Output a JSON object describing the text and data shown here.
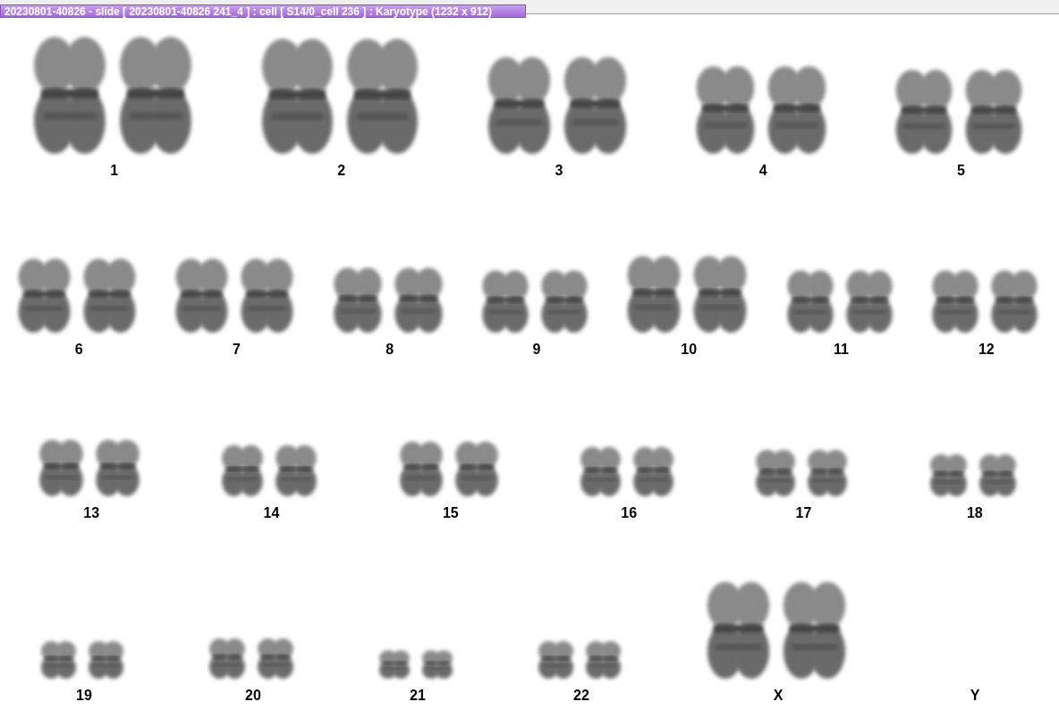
{
  "window": {
    "title": "20230801-40826 - slide [ 20230801-40826 241_4 ] : cell [ S14/0_cell 236 ] : Karyotype  (1232 x 912)"
  },
  "karyotype": {
    "rows": [
      {
        "pairs": [
          {
            "label": "1",
            "kind": "pair"
          },
          {
            "label": "2",
            "kind": "pair"
          },
          {
            "label": "3",
            "kind": "pair"
          },
          {
            "label": "4",
            "kind": "pair"
          },
          {
            "label": "5",
            "kind": "pair"
          }
        ]
      },
      {
        "pairs": [
          {
            "label": "6",
            "kind": "pair"
          },
          {
            "label": "7",
            "kind": "pair"
          },
          {
            "label": "8",
            "kind": "pair"
          },
          {
            "label": "9",
            "kind": "pair"
          },
          {
            "label": "10",
            "kind": "pair"
          },
          {
            "label": "11",
            "kind": "pair"
          },
          {
            "label": "12",
            "kind": "pair"
          }
        ]
      },
      {
        "pairs": [
          {
            "label": "13",
            "kind": "pair"
          },
          {
            "label": "14",
            "kind": "pair"
          },
          {
            "label": "15",
            "kind": "pair"
          },
          {
            "label": "16",
            "kind": "pair"
          },
          {
            "label": "17",
            "kind": "pair"
          },
          {
            "label": "18",
            "kind": "pair"
          }
        ]
      },
      {
        "pairs": [
          {
            "label": "19",
            "kind": "pair"
          },
          {
            "label": "20",
            "kind": "pair"
          },
          {
            "label": "21",
            "kind": "pair"
          },
          {
            "label": "22",
            "kind": "pair"
          },
          {
            "label": "X",
            "kind": "pair"
          },
          {
            "label": "Y",
            "kind": "none"
          }
        ]
      }
    ]
  }
}
